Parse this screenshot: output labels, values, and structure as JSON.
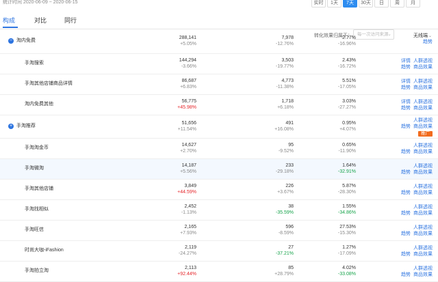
{
  "period": "统计时间 2020-06-09 ~ 2020-06-15",
  "range_buttons": [
    {
      "label": "实时",
      "active": false
    },
    {
      "label": "1天",
      "active": false
    },
    {
      "label": "7天",
      "active": true
    },
    {
      "label": "30天",
      "active": false
    },
    {
      "label": "日",
      "active": false
    },
    {
      "label": "周",
      "active": false
    },
    {
      "label": "月",
      "active": false
    }
  ],
  "tabs": [
    {
      "label": "构成",
      "active": true
    },
    {
      "label": "对比",
      "active": false
    },
    {
      "label": "同行",
      "active": false
    }
  ],
  "filter": {
    "label": "转化效果归属于：",
    "select_placeholder": "每一次访问来源",
    "mode": "无线端"
  },
  "colors": {
    "accent": "#2d74e0",
    "up": "#e5252a",
    "down": "#16a34a",
    "promote": "#f26b1d"
  },
  "rows": [
    {
      "name": "淘内免费",
      "expandable": true,
      "m1": {
        "v": "288,141",
        "c": "+5.05%"
      },
      "m2": {
        "v": "7,978",
        "c": "-12.76%"
      },
      "m3": {
        "v": "2.77%",
        "c": "-16.96%"
      },
      "actions": [
        "趋势"
      ],
      "promote": null
    },
    {
      "name": "手淘搜索",
      "expandable": false,
      "m1": {
        "v": "144,294",
        "c": "-3.66%"
      },
      "m2": {
        "v": "3,503",
        "c": "-19.77%"
      },
      "m3": {
        "v": "2.43%",
        "c": "-16.72%"
      },
      "actions": [
        "详情",
        "人群透视",
        "趋势",
        "商品效果"
      ],
      "promote": null
    },
    {
      "name": "手淘其他店铺商品详情",
      "expandable": false,
      "m1": {
        "v": "86,687",
        "c": "+6.83%"
      },
      "m2": {
        "v": "4,773",
        "c": "-11.38%"
      },
      "m3": {
        "v": "5.51%",
        "c": "-17.05%"
      },
      "actions": [
        "详情",
        "人群透视",
        "趋势",
        "商品效果"
      ],
      "promote": null
    },
    {
      "name": "淘内免费其他",
      "expandable": false,
      "m1": {
        "v": "56,775",
        "c": "+45.98%"
      },
      "m2": {
        "v": "1,718",
        "c": "+6.18%"
      },
      "m3": {
        "v": "3.03%",
        "c": "-27.27%"
      },
      "actions": [
        "详情",
        "人群透视",
        "趋势",
        "商品效果"
      ],
      "promote": null
    },
    {
      "name": "手淘推荐",
      "expandable": true,
      "m1": {
        "v": "51,656",
        "c": "+11.54%"
      },
      "m2": {
        "v": "491",
        "c": "+16.08%"
      },
      "m3": {
        "v": "0.95%",
        "c": "+4.07%"
      },
      "actions": [
        "人群透视",
        "趋势",
        "商品效果"
      ],
      "promote": "推广"
    },
    {
      "name": "手淘淘金币",
      "expandable": false,
      "m1": {
        "v": "14,627",
        "c": "+2.70%"
      },
      "m2": {
        "v": "95",
        "c": "-9.52%"
      },
      "m3": {
        "v": "0.65%",
        "c": "-11.90%"
      },
      "actions": [
        "人群透视",
        "趋势",
        "商品效果"
      ],
      "promote": null
    },
    {
      "name": "手淘微淘",
      "expandable": false,
      "m1": {
        "v": "14,187",
        "c": "+5.56%"
      },
      "m2": {
        "v": "233",
        "c": "-29.18%"
      },
      "m3": {
        "v": "1.64%",
        "c": "-32.91%"
      },
      "actions": [
        "人群透视",
        "趋势",
        "商品效果"
      ],
      "promote": null
    },
    {
      "name": "手淘其他店铺",
      "expandable": false,
      "m1": {
        "v": "3,849",
        "c": "+44.59%"
      },
      "m2": {
        "v": "226",
        "c": "+3.67%"
      },
      "m3": {
        "v": "5.87%",
        "c": "-28.30%"
      },
      "actions": [
        "人群透视",
        "趋势",
        "商品效果"
      ],
      "promote": null
    },
    {
      "name": "手淘找相似",
      "expandable": false,
      "m1": {
        "v": "2,452",
        "c": "-1.13%"
      },
      "m2": {
        "v": "38",
        "c": "-35.59%"
      },
      "m3": {
        "v": "1.55%",
        "c": "-34.86%"
      },
      "actions": [
        "人群透视",
        "趋势",
        "商品效果"
      ],
      "promote": null
    },
    {
      "name": "手淘旺信",
      "expandable": false,
      "m1": {
        "v": "2,165",
        "c": "+7.93%"
      },
      "m2": {
        "v": "596",
        "c": "-8.59%"
      },
      "m3": {
        "v": "27.53%",
        "c": "-15.30%"
      },
      "actions": [
        "人群透视",
        "趋势",
        "商品效果"
      ],
      "promote": null
    },
    {
      "name": "时尚大咖-iFashion",
      "expandable": false,
      "m1": {
        "v": "2,119",
        "c": "-24.27%"
      },
      "m2": {
        "v": "27",
        "c": "-37.21%"
      },
      "m3": {
        "v": "1.27%",
        "c": "-17.09%"
      },
      "actions": [
        "人群透视",
        "趋势",
        "商品效果"
      ],
      "promote": null
    },
    {
      "name": "手淘拍立淘",
      "expandable": false,
      "m1": {
        "v": "2,113",
        "c": "+92.44%"
      },
      "m2": {
        "v": "85",
        "c": "+28.79%"
      },
      "m3": {
        "v": "4.02%",
        "c": "-33.08%"
      },
      "actions": [
        "人群透视",
        "趋势",
        "商品效果"
      ],
      "promote": null
    }
  ]
}
